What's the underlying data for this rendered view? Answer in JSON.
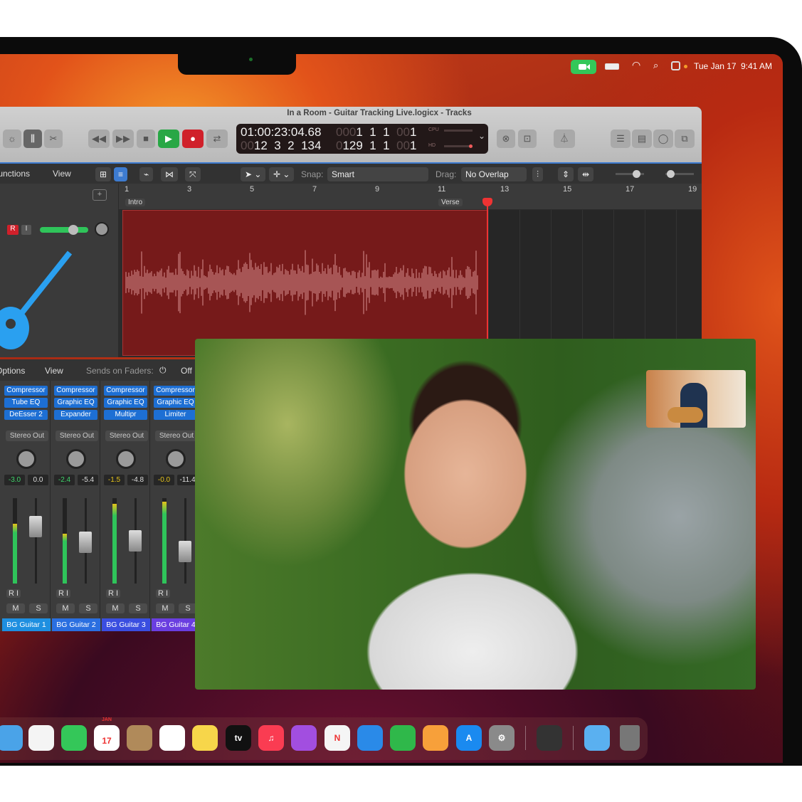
{
  "menubar": {
    "date": "Tue Jan 17",
    "time": "9:41 AM",
    "icons": [
      "facetime-video-icon",
      "battery-icon",
      "wifi-icon",
      "search-icon",
      "control-center-icon"
    ]
  },
  "logic": {
    "title": "In a Room - Guitar Tracking Live.logicx - Tracks",
    "lcd": {
      "time": "01:00:23:04.68",
      "pos_dim": "00",
      "pos": "12  3  2  134",
      "bar1_dim": "000",
      "bar1": "1  1  1",
      "bar1_dim2": "00",
      "bar1_end": "1",
      "bar2_dim": "0",
      "bar2": "129  1  1",
      "bar2_dim2": "00",
      "bar2_end": "1",
      "cpu": "CPU",
      "hd": "HD"
    },
    "controlbar": {
      "functions": "Functions",
      "view": "View",
      "snap_label": "Snap:",
      "snap": "Smart",
      "drag_label": "Drag:",
      "drag": "No Overlap"
    },
    "ruler": [
      "1",
      "3",
      "5",
      "7",
      "9",
      "11",
      "13",
      "15",
      "17",
      "19"
    ],
    "markers": {
      "intro": "Intro",
      "verse": "Verse"
    },
    "track": {
      "record": "R",
      "input": "I"
    }
  },
  "mixer": {
    "options": "Options",
    "view": "View",
    "sends_label": "Sends on Faders:",
    "sends": "Off",
    "channels": [
      {
        "name": "BG Guitar 1",
        "plugins": [
          "Compressor",
          "Tube EQ",
          "DeEsser 2"
        ],
        "output": "Stereo Out",
        "gain": "-3.0",
        "peak": "0.0",
        "level": 0.7,
        "fader": 0.25,
        "color": "#1e8fe0"
      },
      {
        "name": "BG Guitar 2",
        "plugins": [
          "Compressor",
          "Graphic EQ",
          "Expander"
        ],
        "output": "Stereo Out",
        "gain": "-2.4",
        "peak": "-5.4",
        "level": 0.58,
        "fader": 0.47,
        "color": "#2a6fe0"
      },
      {
        "name": "BG Guitar 3",
        "plugins": [
          "Compressor",
          "Graphic EQ",
          "Multipr"
        ],
        "output": "Stereo Out",
        "gain": "-1.5",
        "peak": "-4.8",
        "level": 0.93,
        "fader": 0.45,
        "color": "#3a4ee0"
      },
      {
        "name": "BG Guitar 4",
        "plugins": [
          "Compressor",
          "Graphic EQ",
          "Limiter"
        ],
        "output": "Stereo Out",
        "gain": "-0.0",
        "peak": "-11.4",
        "level": 0.96,
        "fader": 0.6,
        "color": "#6a3ee0"
      }
    ],
    "ri": "R  I",
    "mute": "M",
    "solo": "S"
  },
  "dock": [
    {
      "name": "maps",
      "color": "#4aa3e8",
      "label": ""
    },
    {
      "name": "photos",
      "color": "#f4f4f4",
      "label": ""
    },
    {
      "name": "facetime",
      "color": "#34c759",
      "label": ""
    },
    {
      "name": "calendar",
      "color": "#ffffff",
      "label": "17"
    },
    {
      "name": "contacts",
      "color": "#b08a5a",
      "label": ""
    },
    {
      "name": "reminders",
      "color": "#ffffff",
      "label": ""
    },
    {
      "name": "notes",
      "color": "#f7d64a",
      "label": ""
    },
    {
      "name": "apple-tv",
      "color": "#111111",
      "label": "tv"
    },
    {
      "name": "music",
      "color": "#fa3c52",
      "label": "♫"
    },
    {
      "name": "podcasts",
      "color": "#a24ee0",
      "label": ""
    },
    {
      "name": "news",
      "color": "#f5f5f5",
      "label": "N"
    },
    {
      "name": "keynote",
      "color": "#2a8ae8",
      "label": ""
    },
    {
      "name": "numbers",
      "color": "#2fb84a",
      "label": ""
    },
    {
      "name": "pages",
      "color": "#f7a03a",
      "label": ""
    },
    {
      "name": "app-store",
      "color": "#1a8af0",
      "label": "A"
    },
    {
      "name": "system-settings",
      "color": "#8a8a8a",
      "label": "⚙"
    },
    {
      "name": "logic-pro",
      "color": "#333333",
      "label": ""
    },
    {
      "name": "downloads",
      "color": "#5ab0f0",
      "label": ""
    },
    {
      "name": "trash",
      "color": "#777777",
      "label": ""
    }
  ],
  "calendar_month": "JAN"
}
